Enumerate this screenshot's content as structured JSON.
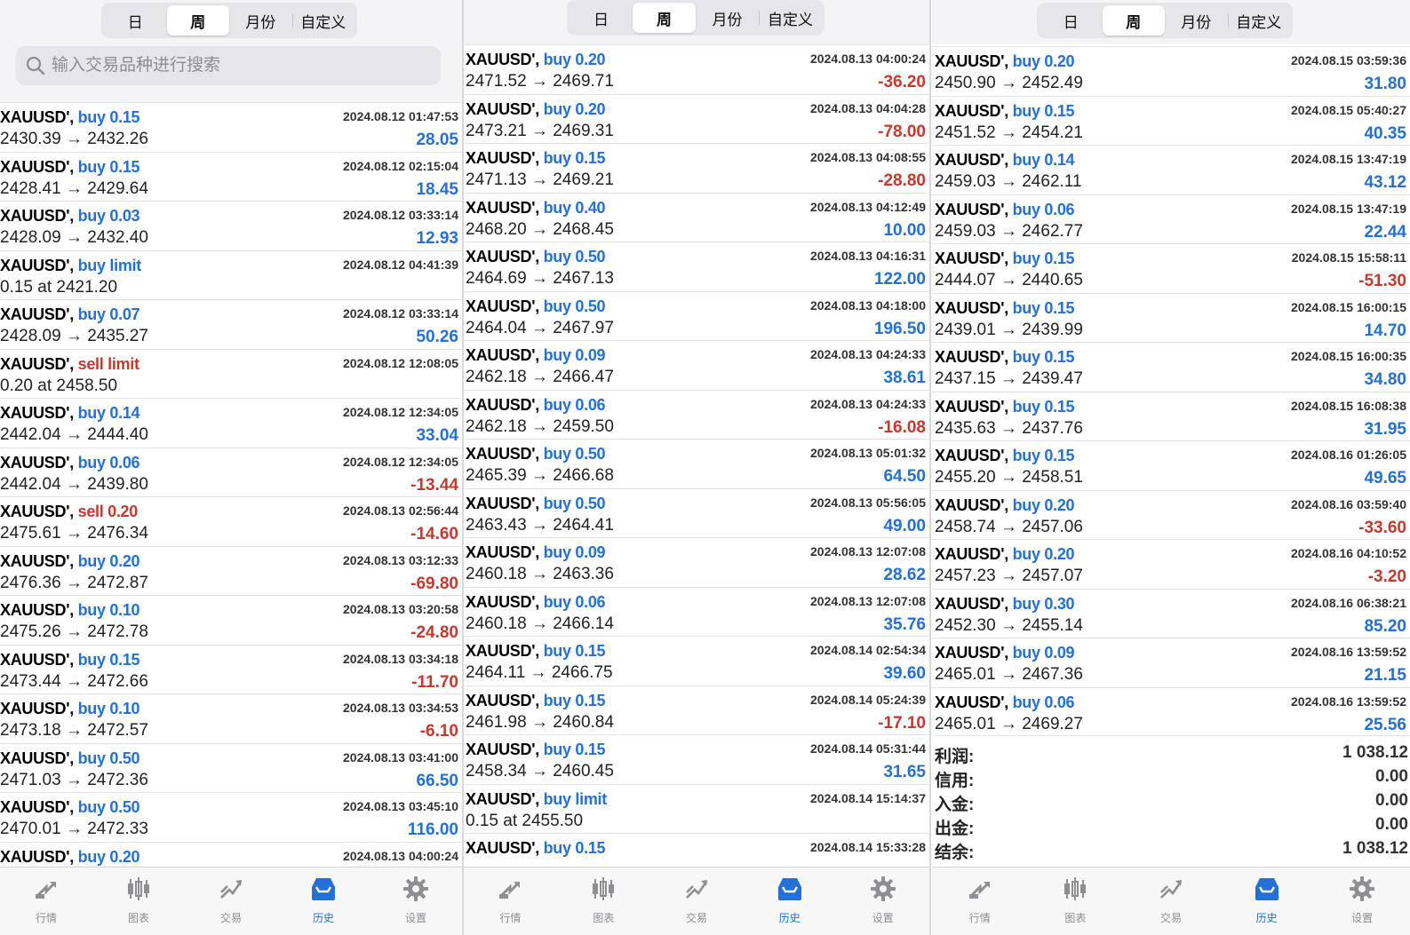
{
  "colors": {
    "buy": "#2370d6",
    "sell": "#c8382c",
    "positive": "#2370d6",
    "negative": "#c8382c",
    "tab_active": "#2370d6",
    "tab_inactive": "#8e8e93"
  },
  "periods": [
    "日",
    "周",
    "月份",
    "自定义"
  ],
  "active_period": "周",
  "search": {
    "placeholder": "输入交易品种进行搜索",
    "icon": "search-icon"
  },
  "tabs": [
    {
      "label": "行情",
      "icon": "quotes-icon"
    },
    {
      "label": "图表",
      "icon": "chart-icon"
    },
    {
      "label": "交易",
      "icon": "trade-icon"
    },
    {
      "label": "历史",
      "icon": "history-icon",
      "active": true
    },
    {
      "label": "设置",
      "icon": "gear-icon"
    }
  ],
  "panels": [
    {
      "trades": [
        {
          "sym": "XAUUSD'",
          "type": "buy 0.15",
          "side": "buy",
          "time": "2024.08.12 01:47:53",
          "prices": "2430.39 → 2432.26",
          "profit": "28.05"
        },
        {
          "sym": "XAUUSD'",
          "type": "buy 0.15",
          "side": "buy",
          "time": "2024.08.12 02:15:04",
          "prices": "2428.41 → 2429.64",
          "profit": "18.45"
        },
        {
          "sym": "XAUUSD'",
          "type": "buy 0.03",
          "side": "buy",
          "time": "2024.08.12 03:33:14",
          "prices": "2428.09 → 2432.40",
          "profit": "12.93"
        },
        {
          "sym": "XAUUSD'",
          "type": "buy limit",
          "side": "buy",
          "time": "2024.08.12 04:41:39",
          "prices": "0.15 at 2421.20",
          "profit": ""
        },
        {
          "sym": "XAUUSD'",
          "type": "buy 0.07",
          "side": "buy",
          "time": "2024.08.12 03:33:14",
          "prices": "2428.09 → 2435.27",
          "profit": "50.26"
        },
        {
          "sym": "XAUUSD'",
          "type": "sell limit",
          "side": "sell",
          "time": "2024.08.12 12:08:05",
          "prices": "0.20 at 2458.50",
          "profit": ""
        },
        {
          "sym": "XAUUSD'",
          "type": "buy 0.14",
          "side": "buy",
          "time": "2024.08.12 12:34:05",
          "prices": "2442.04 → 2444.40",
          "profit": "33.04"
        },
        {
          "sym": "XAUUSD'",
          "type": "buy 0.06",
          "side": "buy",
          "time": "2024.08.12 12:34:05",
          "prices": "2442.04 → 2439.80",
          "profit": "-13.44"
        },
        {
          "sym": "XAUUSD'",
          "type": "sell 0.20",
          "side": "sell",
          "time": "2024.08.13 02:56:44",
          "prices": "2475.61 → 2476.34",
          "profit": "-14.60"
        },
        {
          "sym": "XAUUSD'",
          "type": "buy 0.20",
          "side": "buy",
          "time": "2024.08.13 03:12:33",
          "prices": "2476.36 → 2472.87",
          "profit": "-69.80"
        },
        {
          "sym": "XAUUSD'",
          "type": "buy 0.10",
          "side": "buy",
          "time": "2024.08.13 03:20:58",
          "prices": "2475.26 → 2472.78",
          "profit": "-24.80"
        },
        {
          "sym": "XAUUSD'",
          "type": "buy 0.15",
          "side": "buy",
          "time": "2024.08.13 03:34:18",
          "prices": "2473.44 → 2472.66",
          "profit": "-11.70"
        },
        {
          "sym": "XAUUSD'",
          "type": "buy 0.10",
          "side": "buy",
          "time": "2024.08.13 03:34:53",
          "prices": "2473.18 → 2472.57",
          "profit": "-6.10"
        },
        {
          "sym": "XAUUSD'",
          "type": "buy 0.50",
          "side": "buy",
          "time": "2024.08.13 03:41:00",
          "prices": "2471.03 → 2472.36",
          "profit": "66.50"
        },
        {
          "sym": "XAUUSD'",
          "type": "buy 0.50",
          "side": "buy",
          "time": "2024.08.13 03:45:10",
          "prices": "2470.01 → 2472.33",
          "profit": "116.00"
        },
        {
          "sym": "XAUUSD'",
          "type": "buy 0.20",
          "side": "buy",
          "time": "2024.08.13 04:00:24",
          "prices": "",
          "profit": ""
        }
      ]
    },
    {
      "trades": [
        {
          "sym": "XAUUSD'",
          "type": "buy 0.20",
          "side": "buy",
          "time": "2024.08.13 04:00:24",
          "prices": "2471.52 → 2469.71",
          "profit": "-36.20"
        },
        {
          "sym": "XAUUSD'",
          "type": "buy 0.20",
          "side": "buy",
          "time": "2024.08.13 04:04:28",
          "prices": "2473.21 → 2469.31",
          "profit": "-78.00"
        },
        {
          "sym": "XAUUSD'",
          "type": "buy 0.15",
          "side": "buy",
          "time": "2024.08.13 04:08:55",
          "prices": "2471.13 → 2469.21",
          "profit": "-28.80"
        },
        {
          "sym": "XAUUSD'",
          "type": "buy 0.40",
          "side": "buy",
          "time": "2024.08.13 04:12:49",
          "prices": "2468.20 → 2468.45",
          "profit": "10.00"
        },
        {
          "sym": "XAUUSD'",
          "type": "buy 0.50",
          "side": "buy",
          "time": "2024.08.13 04:16:31",
          "prices": "2464.69 → 2467.13",
          "profit": "122.00"
        },
        {
          "sym": "XAUUSD'",
          "type": "buy 0.50",
          "side": "buy",
          "time": "2024.08.13 04:18:00",
          "prices": "2464.04 → 2467.97",
          "profit": "196.50"
        },
        {
          "sym": "XAUUSD'",
          "type": "buy 0.09",
          "side": "buy",
          "time": "2024.08.13 04:24:33",
          "prices": "2462.18 → 2466.47",
          "profit": "38.61"
        },
        {
          "sym": "XAUUSD'",
          "type": "buy 0.06",
          "side": "buy",
          "time": "2024.08.13 04:24:33",
          "prices": "2462.18 → 2459.50",
          "profit": "-16.08"
        },
        {
          "sym": "XAUUSD'",
          "type": "buy 0.50",
          "side": "buy",
          "time": "2024.08.13 05:01:32",
          "prices": "2465.39 → 2466.68",
          "profit": "64.50"
        },
        {
          "sym": "XAUUSD'",
          "type": "buy 0.50",
          "side": "buy",
          "time": "2024.08.13 05:56:05",
          "prices": "2463.43 → 2464.41",
          "profit": "49.00"
        },
        {
          "sym": "XAUUSD'",
          "type": "buy 0.09",
          "side": "buy",
          "time": "2024.08.13 12:07:08",
          "prices": "2460.18 → 2463.36",
          "profit": "28.62"
        },
        {
          "sym": "XAUUSD'",
          "type": "buy 0.06",
          "side": "buy",
          "time": "2024.08.13 12:07:08",
          "prices": "2460.18 → 2466.14",
          "profit": "35.76"
        },
        {
          "sym": "XAUUSD'",
          "type": "buy 0.15",
          "side": "buy",
          "time": "2024.08.14 02:54:34",
          "prices": "2464.11 → 2466.75",
          "profit": "39.60"
        },
        {
          "sym": "XAUUSD'",
          "type": "buy 0.15",
          "side": "buy",
          "time": "2024.08.14 05:24:39",
          "prices": "2461.98 → 2460.84",
          "profit": "-17.10"
        },
        {
          "sym": "XAUUSD'",
          "type": "buy 0.15",
          "side": "buy",
          "time": "2024.08.14 05:31:44",
          "prices": "2458.34 → 2460.45",
          "profit": "31.65"
        },
        {
          "sym": "XAUUSD'",
          "type": "buy limit",
          "side": "buy",
          "time": "2024.08.14 15:14:37",
          "prices": "0.15 at 2455.50",
          "profit": ""
        },
        {
          "sym": "XAUUSD'",
          "type": "buy 0.15",
          "side": "buy",
          "time": "2024.08.14 15:33:28",
          "prices": "",
          "profit": ""
        }
      ]
    },
    {
      "trades": [
        {
          "sym": "XAUUSD'",
          "type": "buy 0.20",
          "side": "buy",
          "time": "2024.08.15 03:59:36",
          "prices": "2450.90 → 2452.49",
          "profit": "31.80"
        },
        {
          "sym": "XAUUSD'",
          "type": "buy 0.15",
          "side": "buy",
          "time": "2024.08.15 05:40:27",
          "prices": "2451.52 → 2454.21",
          "profit": "40.35"
        },
        {
          "sym": "XAUUSD'",
          "type": "buy 0.14",
          "side": "buy",
          "time": "2024.08.15 13:47:19",
          "prices": "2459.03 → 2462.11",
          "profit": "43.12"
        },
        {
          "sym": "XAUUSD'",
          "type": "buy 0.06",
          "side": "buy",
          "time": "2024.08.15 13:47:19",
          "prices": "2459.03 → 2462.77",
          "profit": "22.44"
        },
        {
          "sym": "XAUUSD'",
          "type": "buy 0.15",
          "side": "buy",
          "time": "2024.08.15 15:58:11",
          "prices": "2444.07 → 2440.65",
          "profit": "-51.30"
        },
        {
          "sym": "XAUUSD'",
          "type": "buy 0.15",
          "side": "buy",
          "time": "2024.08.15 16:00:15",
          "prices": "2439.01 → 2439.99",
          "profit": "14.70"
        },
        {
          "sym": "XAUUSD'",
          "type": "buy 0.15",
          "side": "buy",
          "time": "2024.08.15 16:00:35",
          "prices": "2437.15 → 2439.47",
          "profit": "34.80"
        },
        {
          "sym": "XAUUSD'",
          "type": "buy 0.15",
          "side": "buy",
          "time": "2024.08.15 16:08:38",
          "prices": "2435.63 → 2437.76",
          "profit": "31.95"
        },
        {
          "sym": "XAUUSD'",
          "type": "buy 0.15",
          "side": "buy",
          "time": "2024.08.16 01:26:05",
          "prices": "2455.20 → 2458.51",
          "profit": "49.65"
        },
        {
          "sym": "XAUUSD'",
          "type": "buy 0.20",
          "side": "buy",
          "time": "2024.08.16 03:59:40",
          "prices": "2458.74 → 2457.06",
          "profit": "-33.60"
        },
        {
          "sym": "XAUUSD'",
          "type": "buy 0.20",
          "side": "buy",
          "time": "2024.08.16 04:10:52",
          "prices": "2457.23 → 2457.07",
          "profit": "-3.20"
        },
        {
          "sym": "XAUUSD'",
          "type": "buy 0.30",
          "side": "buy",
          "time": "2024.08.16 06:38:21",
          "prices": "2452.30 → 2455.14",
          "profit": "85.20"
        },
        {
          "sym": "XAUUSD'",
          "type": "buy 0.09",
          "side": "buy",
          "time": "2024.08.16 13:59:52",
          "prices": "2465.01 → 2467.36",
          "profit": "21.15"
        },
        {
          "sym": "XAUUSD'",
          "type": "buy 0.06",
          "side": "buy",
          "time": "2024.08.16 13:59:52",
          "prices": "2465.01 → 2469.27",
          "profit": "25.56"
        }
      ],
      "summary": [
        {
          "label": "利润:",
          "value": "1 038.12"
        },
        {
          "label": "信用:",
          "value": "0.00"
        },
        {
          "label": "入金:",
          "value": "0.00"
        },
        {
          "label": "出金:",
          "value": "0.00"
        },
        {
          "label": "结余:",
          "value": "1 038.12"
        }
      ]
    }
  ]
}
